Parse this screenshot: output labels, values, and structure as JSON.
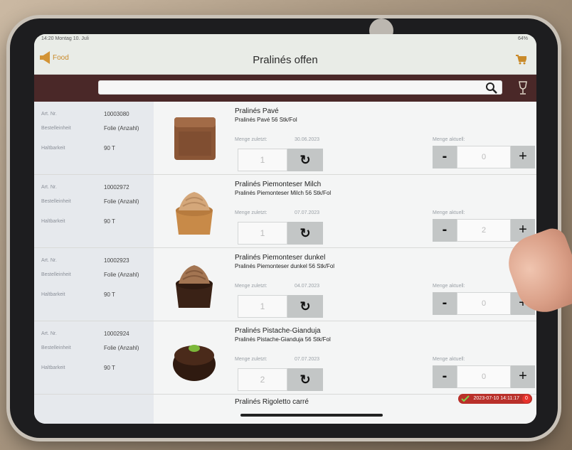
{
  "status": {
    "time": "14:20  Montag 10. Juli",
    "battery": "64%"
  },
  "nav": {
    "back_label": "Food",
    "title": "Pralinés offen"
  },
  "search": {
    "value": ""
  },
  "labels": {
    "art_nr": "Art. Nr.",
    "bestelleinheit": "Bestelleinheit",
    "haltbarkeit": "Haltbarkeit",
    "menge_zuletzt": "Menge zuletzt:",
    "menge_aktuell": "Menge aktuell:",
    "minus": "-",
    "plus": "+"
  },
  "products": [
    {
      "art_nr": "10003080",
      "unit": "Folie (Anzahl)",
      "shelf": "90 T",
      "name": "Pralinés Pavé",
      "sub": "Pralinés Pavé 56 Stk/Fol",
      "last_date": "30.06.2023",
      "last_qty": "1",
      "cur_qty": "0"
    },
    {
      "art_nr": "10002972",
      "unit": "Folie (Anzahl)",
      "shelf": "90 T",
      "name": "Pralinés Piemonteser Milch",
      "sub": "Pralinés Piemonteser Milch 56 Stk/Fol",
      "last_date": "07.07.2023",
      "last_qty": "1",
      "cur_qty": "2"
    },
    {
      "art_nr": "10002923",
      "unit": "Folie (Anzahl)",
      "shelf": "90 T",
      "name": "Pralinés Piemonteser dunkel",
      "sub": "Pralinés Piemonteser dunkel 56 Stk/Fol",
      "last_date": "04.07.2023",
      "last_qty": "1",
      "cur_qty": "0"
    },
    {
      "art_nr": "10002924",
      "unit": "Folie (Anzahl)",
      "shelf": "90 T",
      "name": "Pralinés Pistache-Gianduja",
      "sub": "Pralinés Pistache-Gianduja 56 Stk/Fol",
      "last_date": "07.07.2023",
      "last_qty": "2",
      "cur_qty": "0"
    }
  ],
  "partial_product": {
    "name": "Pralinés Rigoletto carré"
  },
  "footer": {
    "timestamp": "2023-07-10 14:11:17",
    "count": "0"
  },
  "colors": {
    "accent": "#c98a2a",
    "searchbar": "#4a2828",
    "badge": "#b9302a"
  }
}
